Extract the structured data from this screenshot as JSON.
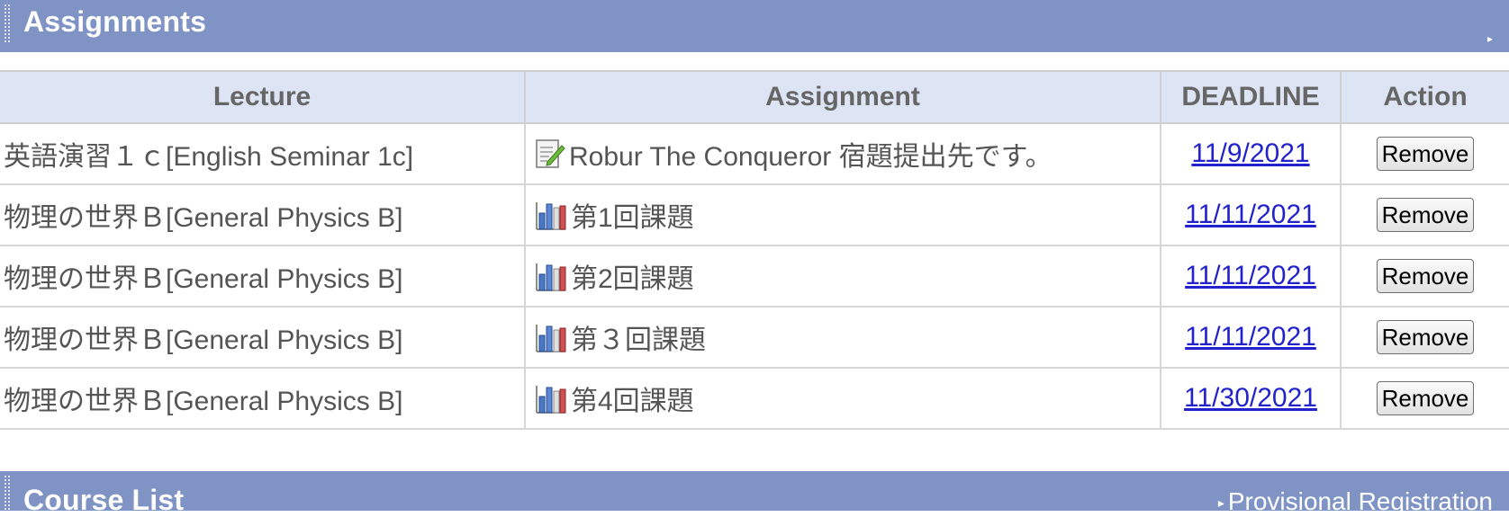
{
  "assignments_panel": {
    "title": "Assignments",
    "collapse_glyph": "▸"
  },
  "table": {
    "headers": {
      "lecture": "Lecture",
      "assignment": "Assignment",
      "deadline": "DEADLINE",
      "action": "Action"
    },
    "rows": [
      {
        "lecture": "英語演習１ｃ[English Seminar 1c]",
        "icon": "report-edit-icon",
        "assignment": "Robur The Conqueror 宿題提出先です。",
        "deadline": "11/9/2021",
        "action": "Remove"
      },
      {
        "lecture": "物理の世界Ｂ[General Physics B]",
        "icon": "bar-chart-icon",
        "assignment": "第1回課題",
        "deadline": "11/11/2021",
        "action": "Remove"
      },
      {
        "lecture": "物理の世界Ｂ[General Physics B]",
        "icon": "bar-chart-icon",
        "assignment": "第2回課題",
        "deadline": "11/11/2021",
        "action": "Remove"
      },
      {
        "lecture": "物理の世界Ｂ[General Physics B]",
        "icon": "bar-chart-icon",
        "assignment": "第３回課題",
        "deadline": "11/11/2021",
        "action": "Remove"
      },
      {
        "lecture": "物理の世界Ｂ[General Physics B]",
        "icon": "bar-chart-icon",
        "assignment": "第4回課題",
        "deadline": "11/30/2021",
        "action": "Remove"
      }
    ]
  },
  "course_panel": {
    "title": "Course List",
    "link": "Provisional Registration",
    "link_bullet": "▸"
  },
  "colors": {
    "header_bar": "#7f93c4",
    "table_header_bg": "#dde5f5",
    "link": "#2222cc"
  }
}
